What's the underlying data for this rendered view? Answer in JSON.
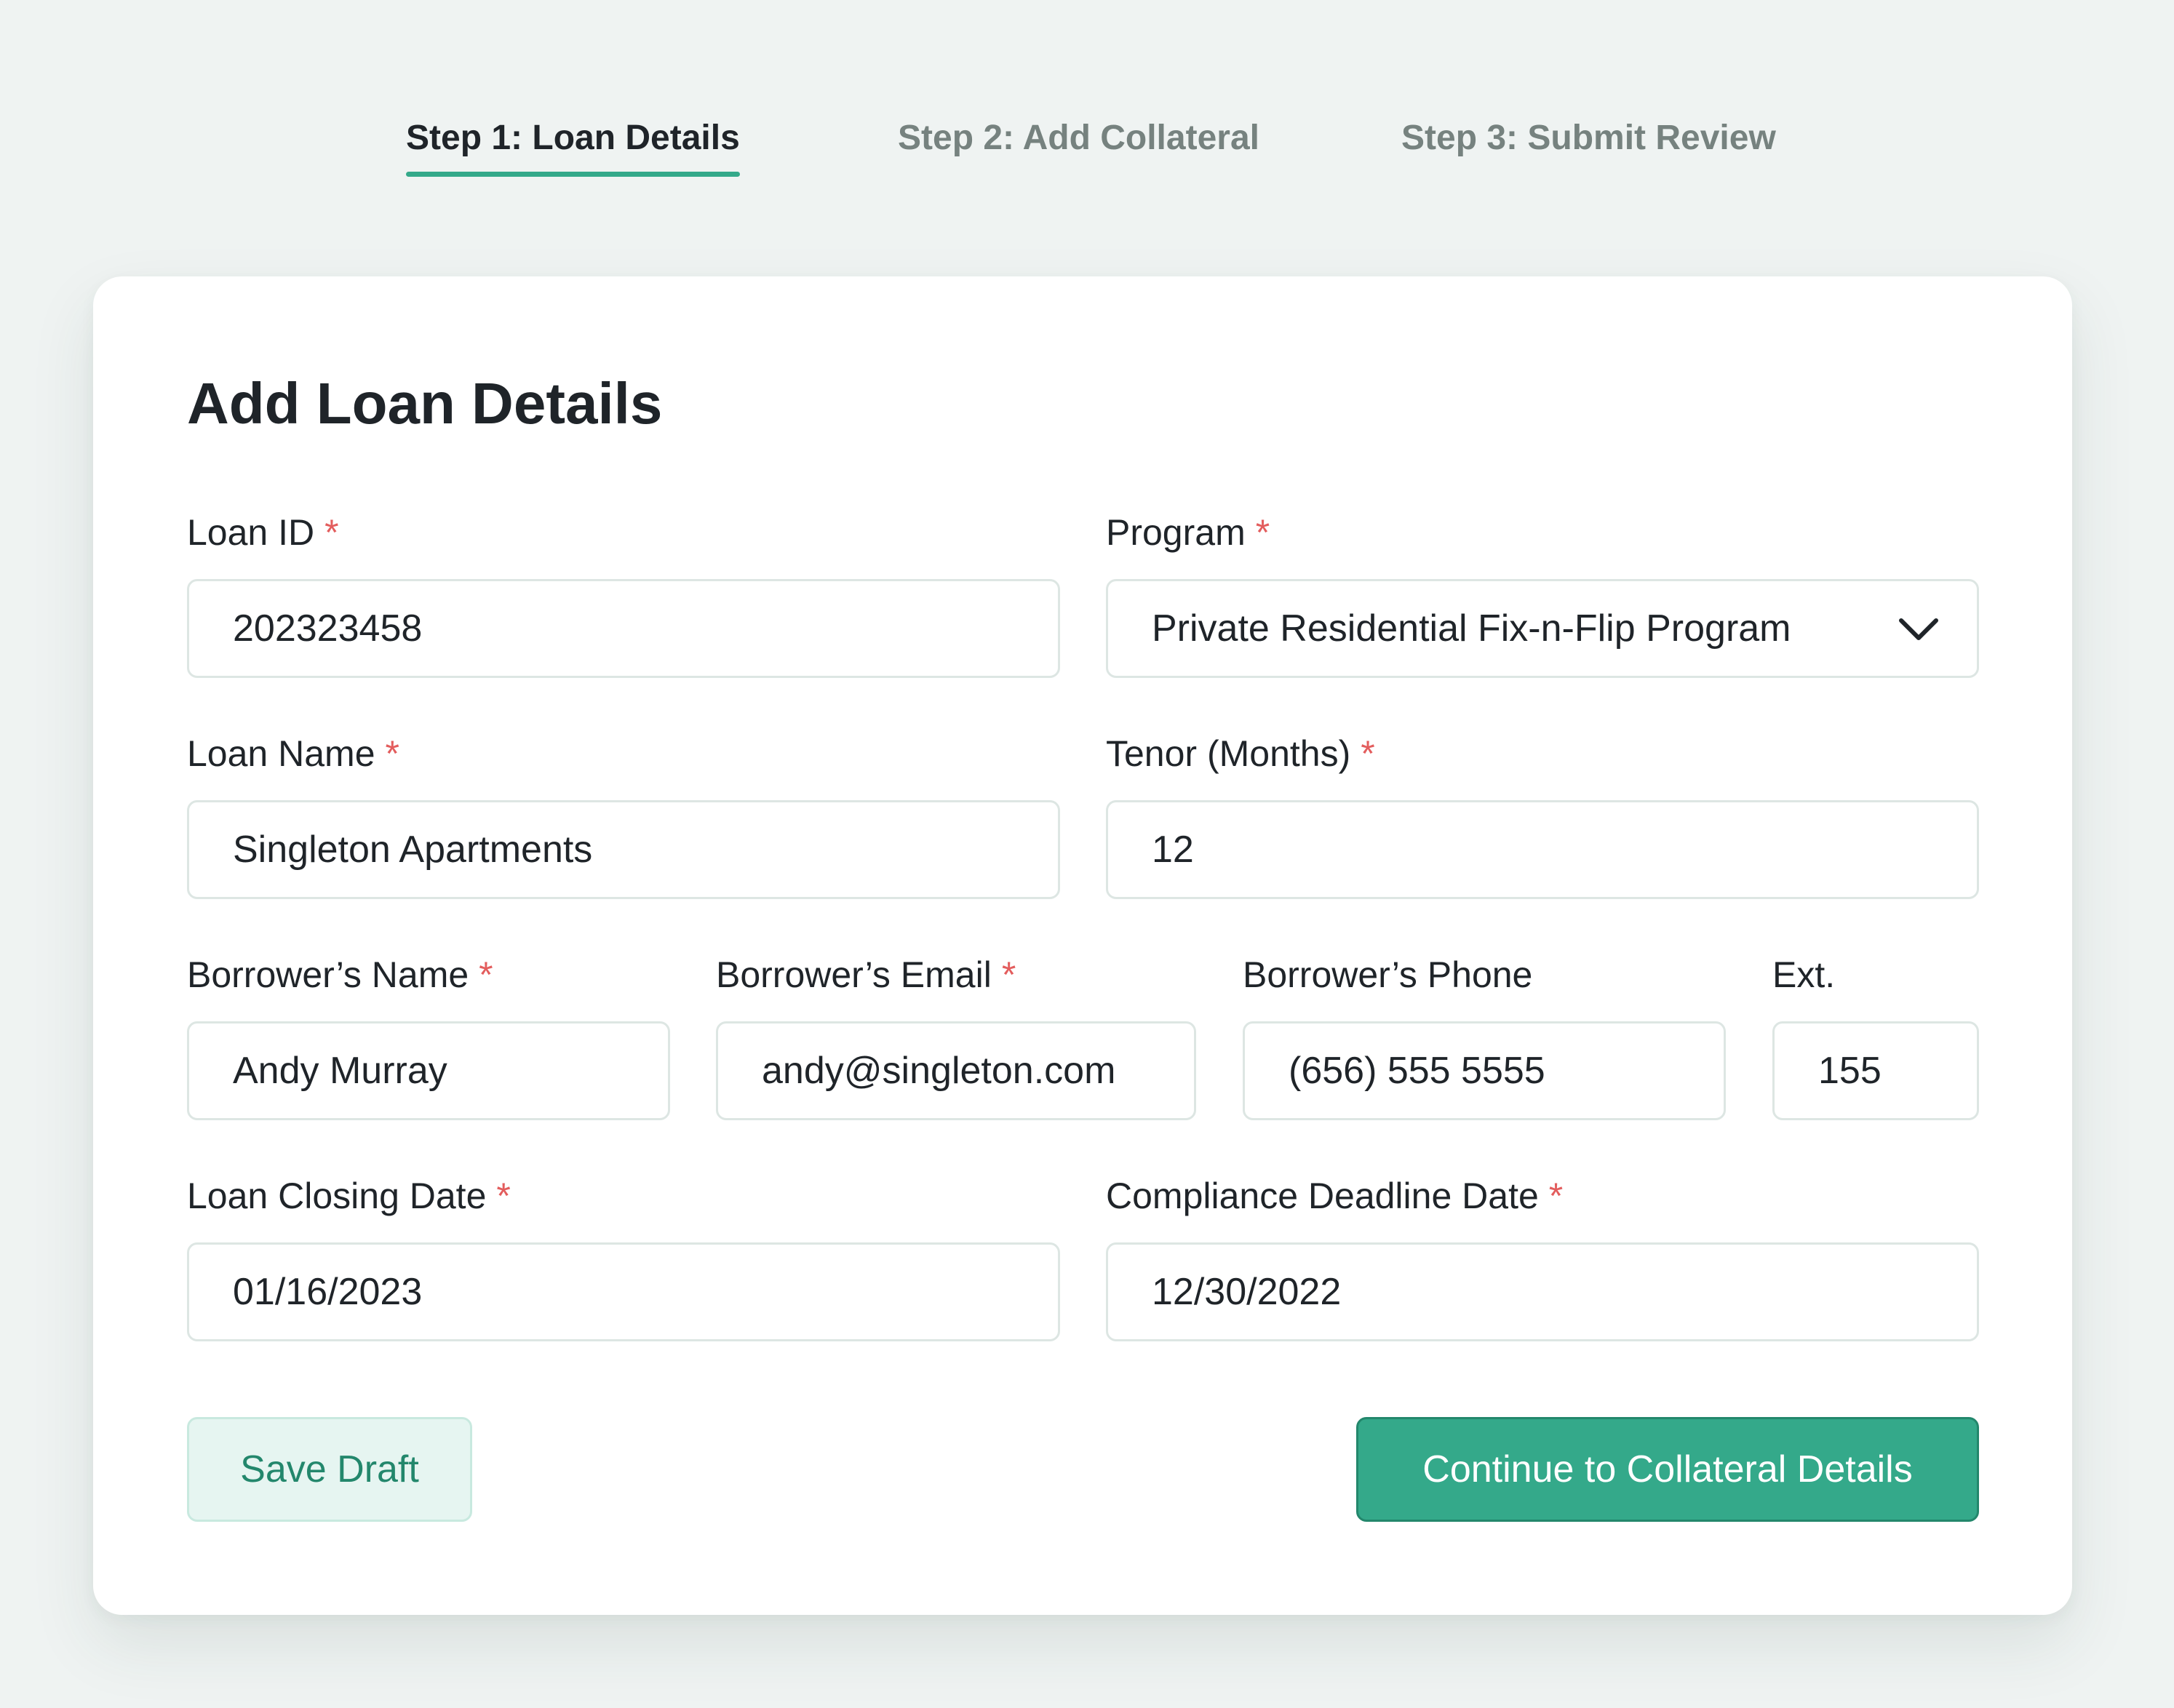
{
  "steps": [
    {
      "label": "Step 1: Loan Details",
      "active": true
    },
    {
      "label": "Step 2: Add Collateral",
      "active": false
    },
    {
      "label": "Step 3: Submit Review",
      "active": false
    }
  ],
  "form": {
    "title": "Add Loan Details",
    "required_marker": "*",
    "loan_id": {
      "label": "Loan ID",
      "value": "202323458",
      "required": true
    },
    "program": {
      "label": "Program",
      "value": "Private Residential Fix-n-Flip Program",
      "required": true,
      "icon": "chevron-down-icon"
    },
    "loan_name": {
      "label": "Loan Name",
      "value": "Singleton Apartments",
      "required": true
    },
    "tenor": {
      "label": "Tenor (Months)",
      "value": "12",
      "required": true
    },
    "borrower_name": {
      "label": "Borrower’s Name",
      "value": "Andy Murray",
      "required": true
    },
    "borrower_email": {
      "label": "Borrower’s Email",
      "value": "andy@singleton.com",
      "required": true
    },
    "borrower_phone": {
      "label": "Borrower’s Phone",
      "value": "(656) 555 5555",
      "required": false
    },
    "ext": {
      "label": "Ext.",
      "value": "155",
      "required": false
    },
    "closing_date": {
      "label": "Loan Closing Date",
      "value": "01/16/2023",
      "required": true
    },
    "compliance_date": {
      "label": "Compliance Deadline Date",
      "value": "12/30/2022",
      "required": true
    }
  },
  "actions": {
    "save_draft": "Save Draft",
    "continue": "Continue to Collateral Details"
  },
  "colors": {
    "accent": "#34a98a",
    "accent_dark": "#23876c",
    "required": "#e35d5d",
    "background": "#eff3f2"
  }
}
